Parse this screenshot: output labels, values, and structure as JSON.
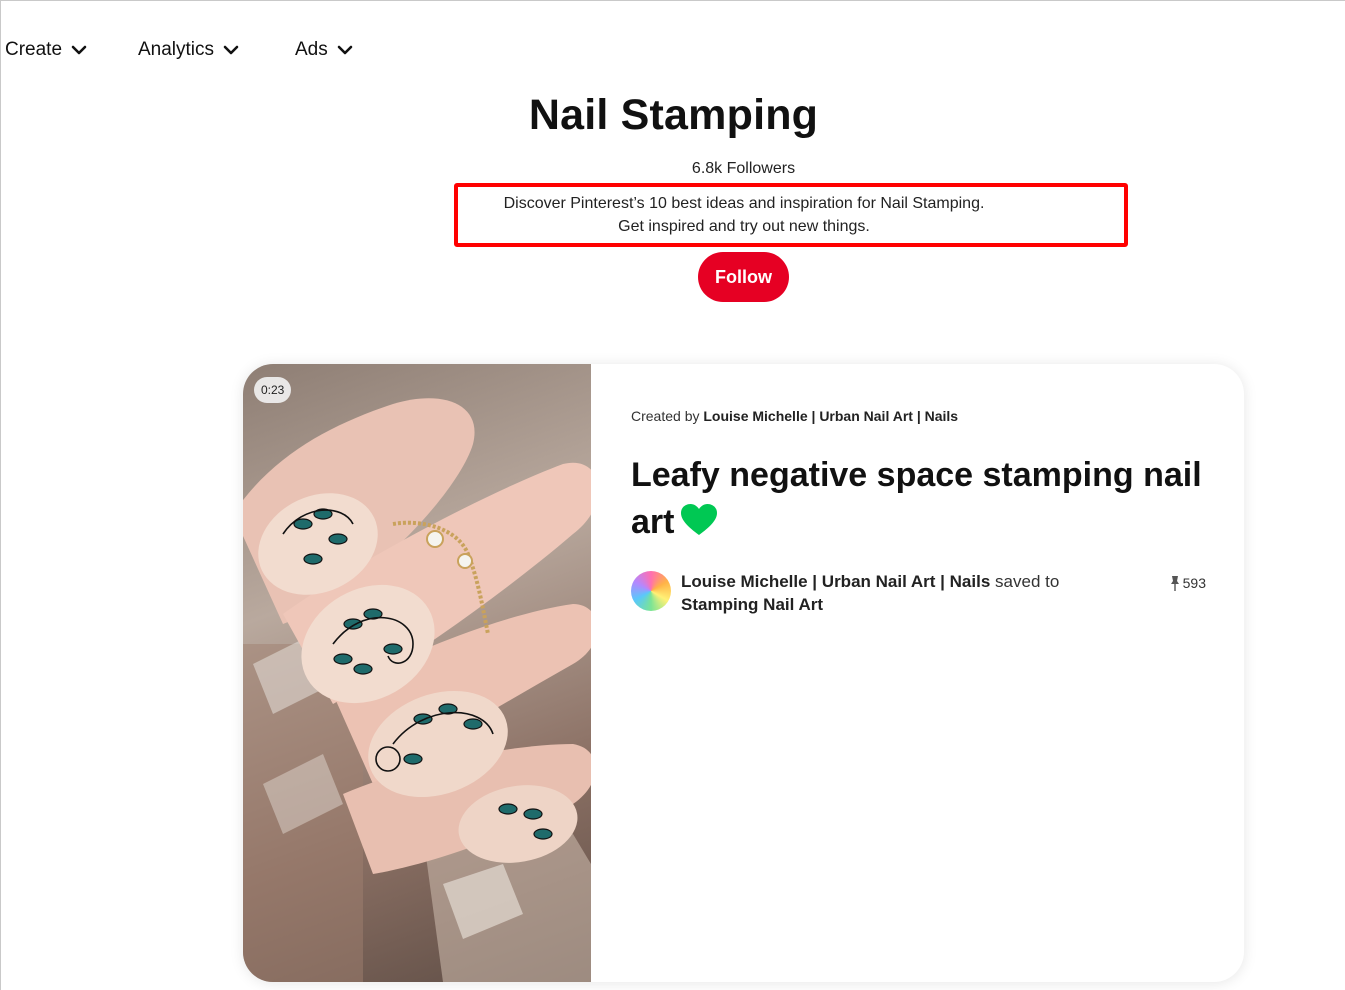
{
  "nav": {
    "create": "Create",
    "analytics": "Analytics",
    "ads": "Ads"
  },
  "board": {
    "title": "Nail Stamping",
    "followers": "6.8k Followers",
    "description_line1": "Discover Pinterest’s 10 best ideas and inspiration for Nail Stamping.",
    "description_line2": "Get inspired and try out new things.",
    "follow_label": "Follow"
  },
  "pin": {
    "duration": "0:23",
    "created_by_prefix": "Created by",
    "creator_name": "Louise Michelle | Urban Nail Art | Nails",
    "title": "Leafy negative space stamping nail art",
    "title_emoji": "green-heart-icon",
    "saver_name": "Louise Michelle | Urban Nail Art | Nails",
    "saved_to_text": "saved to",
    "board_name": "Stamping Nail Art",
    "save_count": "593"
  },
  "colors": {
    "follow_button": "#e60023",
    "highlight_box": "#ff0000",
    "heart": "#00c853"
  }
}
